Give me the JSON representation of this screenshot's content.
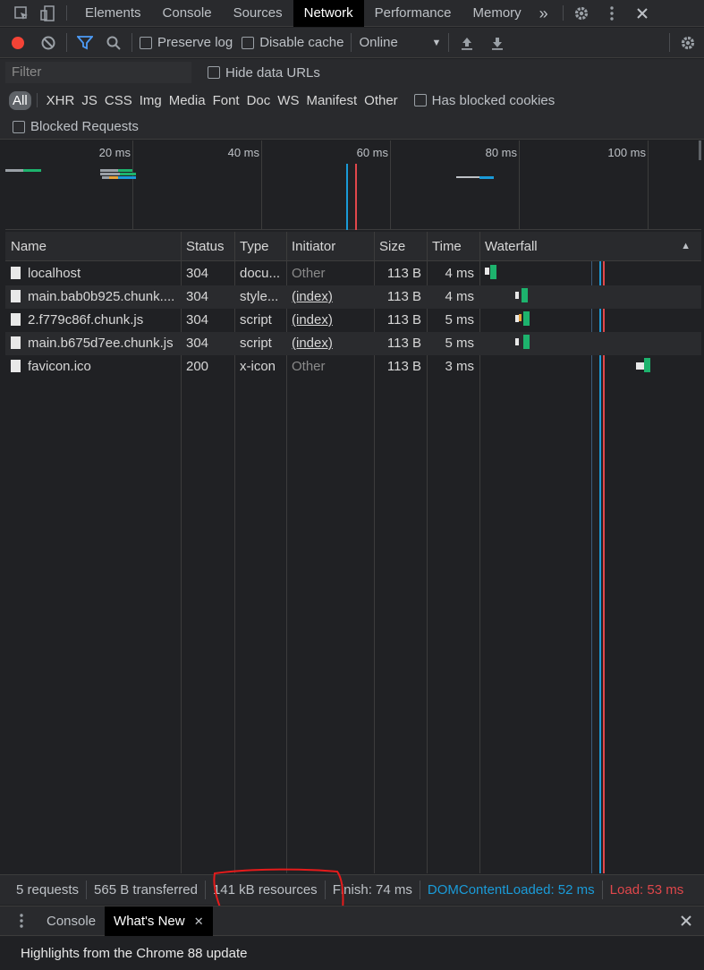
{
  "topbar": {
    "tabs": [
      "Elements",
      "Console",
      "Sources",
      "Network",
      "Performance",
      "Memory"
    ],
    "active_tab": "Network",
    "more": "»"
  },
  "toolbar": {
    "preserve_log": "Preserve log",
    "disable_cache": "Disable cache",
    "throttle": "Online"
  },
  "filter": {
    "placeholder": "Filter",
    "hide_data_urls": "Hide data URLs",
    "types": [
      "All",
      "XHR",
      "JS",
      "CSS",
      "Img",
      "Media",
      "Font",
      "Doc",
      "WS",
      "Manifest",
      "Other"
    ],
    "has_blocked_cookies": "Has blocked cookies",
    "blocked_requests": "Blocked Requests"
  },
  "overview": {
    "ticks": [
      "20 ms",
      "40 ms",
      "60 ms",
      "80 ms",
      "100 ms"
    ]
  },
  "table": {
    "columns": [
      "Name",
      "Status",
      "Type",
      "Initiator",
      "Size",
      "Time",
      "Waterfall"
    ],
    "rows": [
      {
        "name": "localhost",
        "status": "304",
        "type": "docu...",
        "initiator": "Other",
        "size": "113 B",
        "time": "4 ms"
      },
      {
        "name": "main.bab0b925.chunk....",
        "status": "304",
        "type": "style...",
        "initiator": "(index)",
        "size": "113 B",
        "time": "4 ms"
      },
      {
        "name": "2.f779c86f.chunk.js",
        "status": "304",
        "type": "script",
        "initiator": "(index)",
        "size": "113 B",
        "time": "5 ms"
      },
      {
        "name": "main.b675d7ee.chunk.js",
        "status": "304",
        "type": "script",
        "initiator": "(index)",
        "size": "113 B",
        "time": "5 ms"
      },
      {
        "name": "favicon.ico",
        "status": "200",
        "type": "x-icon",
        "initiator": "Other",
        "size": "113 B",
        "time": "3 ms"
      }
    ]
  },
  "status": {
    "requests": "5 requests",
    "transferred": "565 B transferred",
    "resources": "141 kB resources",
    "finish": "Finish: 74 ms",
    "dom_content_loaded": "DOMContentLoaded: 52 ms",
    "load": "Load: 53 ms"
  },
  "drawer": {
    "tabs": [
      "Console",
      "What's New"
    ],
    "active_tab": "What's New",
    "body": "Highlights from the Chrome 88 update"
  },
  "colors": {
    "accent_blue": "#1a9bd8",
    "load_red": "#e0474b",
    "record_red": "#f44336",
    "filter_blue": "#4d9cf8",
    "wf_green": "#1db36d",
    "annotation_red": "#e51b1b"
  }
}
